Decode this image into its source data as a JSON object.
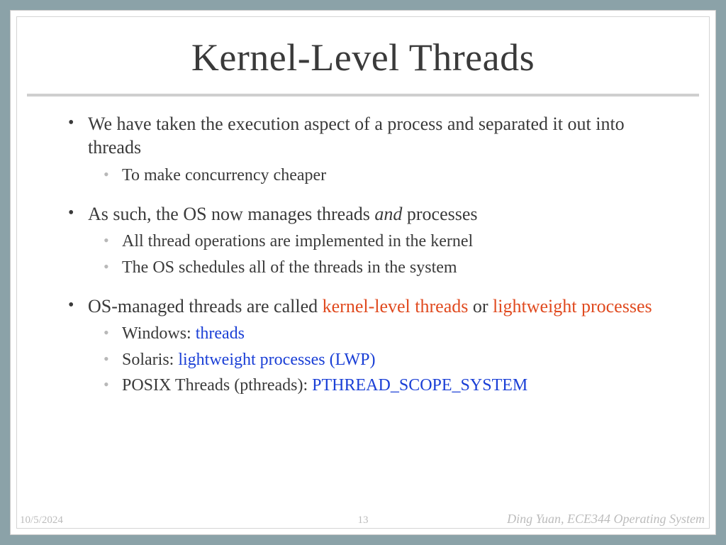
{
  "title": "Kernel-Level Threads",
  "groups": [
    {
      "main": "We have taken the execution aspect of a process and separated it out into threads",
      "subs": [
        {
          "text": "To make concurrency cheaper"
        }
      ]
    },
    {
      "main_parts": [
        "As such, the OS now manages threads ",
        "and",
        " processes"
      ],
      "subs": [
        {
          "text": "All thread operations are implemented in the kernel"
        },
        {
          "text": "The OS schedules all of the threads in the system"
        }
      ]
    },
    {
      "main_parts3": [
        "OS-managed threads are called ",
        "kernel-level threads",
        " or ",
        "lightweight processes"
      ],
      "subs": [
        {
          "prefix": "Windows: ",
          "hl": "threads"
        },
        {
          "prefix": "Solaris: ",
          "hl": "lightweight processes (LWP)"
        },
        {
          "prefix": "POSIX Threads (pthreads): ",
          "hl": "PTHREAD_SCOPE_SYSTEM"
        }
      ]
    }
  ],
  "footer": {
    "date": "10/5/2024",
    "page": "13",
    "author": "Ding Yuan, ECE344 Operating System"
  }
}
